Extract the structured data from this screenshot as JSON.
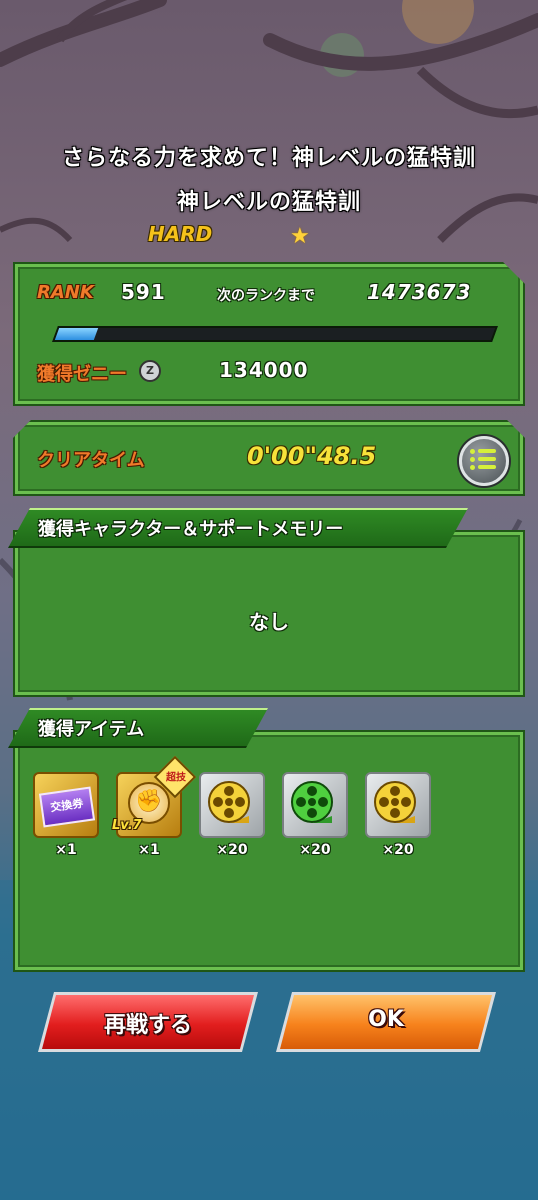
{
  "stage": {
    "title": "さらなる力を求めて！神レベルの猛特訓",
    "subtitle": "神レベルの猛特訓",
    "difficulty": "HARD"
  },
  "rank": {
    "label": "RANK",
    "value": "591",
    "next_label": "次のランクまで",
    "next_value": "1473673",
    "progress": 0.09
  },
  "zeni": {
    "label": "獲得ゼニー",
    "icon_letter": "Z",
    "value": "134000"
  },
  "clear": {
    "label": "クリアタイム",
    "time": "0'00\"48.5"
  },
  "characters_section": {
    "header": "獲得キャラクター＆サポートメモリー",
    "empty_text": "なし"
  },
  "items_section": {
    "header": "獲得アイテム",
    "items": [
      {
        "icon": "exchange-ticket-icon",
        "label": "交換券",
        "qty": "×1"
      },
      {
        "icon": "super-attack-fist-icon",
        "tag": "超技",
        "level": "Lv.7",
        "qty": "×1"
      },
      {
        "icon": "gold-film-reel-icon",
        "qty": "×20"
      },
      {
        "icon": "green-film-reel-icon",
        "qty": "×20"
      },
      {
        "icon": "gold-film-reel-icon",
        "qty": "×20"
      }
    ]
  },
  "buttons": {
    "retry": "再戦する",
    "ok": "OK"
  },
  "colors": {
    "panel_green": "#3f8f32",
    "label_orange": "#f07a2a",
    "time_yellow": "#f7e23a",
    "retry_red": "#e21e1e",
    "ok_orange": "#f7821c"
  }
}
